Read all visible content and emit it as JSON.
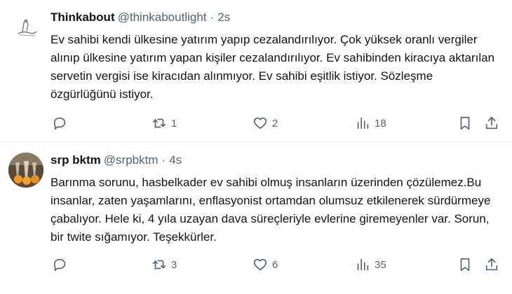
{
  "tweets": [
    {
      "name": "Thinkabout",
      "handle": "@thinkaboutlight",
      "separator": "·",
      "time": "2s",
      "text": "Ev sahibi kendi ülkesine yatırım yapıp cezalandırılıyor. Çok yüksek oranlı vergiler alınıp ülkesine yatırım yapan kişiler cezalandırılıyor. Ev sahibinden kiracıya aktarılan servetin vergisi ise kiracıdan alınmıyor. Ev sahibi eşitlik istiyor. Sözleşme özgürlüğünü istiyor.",
      "reply_count": "",
      "retweet_count": "1",
      "like_count": "2",
      "view_count": "18"
    },
    {
      "name": "srp bktm",
      "handle": "@srpbktm",
      "separator": "·",
      "time": "4s",
      "text": "Barınma sorunu, hasbelkader ev sahibi olmuş insanların üzerinden çözülemez.Bu insanlar, zaten yaşamlarını, enflasyonist ortamdan olumsuz etkilenerek sürdürmeye çabalıyor. Hele ki, 4 yıla uzayan dava süreçleriyle evlerine giremeyenler var. Sorun, bir twite sığamıyor. Teşekkürler.",
      "reply_count": "",
      "retweet_count": "3",
      "like_count": "6",
      "view_count": "35"
    }
  ],
  "icons": {
    "reply": "reply-icon",
    "retweet": "retweet-icon",
    "like": "heart-icon",
    "views": "views-icon",
    "bookmark": "bookmark-icon",
    "share": "share-icon"
  },
  "colors": {
    "text": "#0f1419",
    "secondary": "#536471",
    "divider": "#eff3f4"
  }
}
